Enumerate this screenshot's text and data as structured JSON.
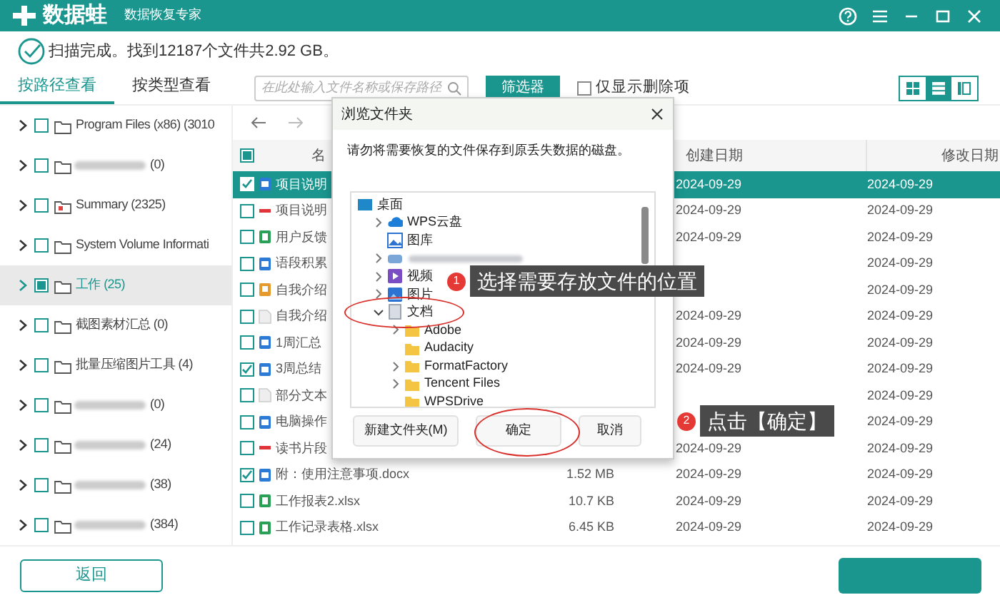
{
  "app": {
    "name": "数据蛙",
    "subtitle": "数据恢复专家"
  },
  "status": "扫描完成。找到12187个文件共2.92 GB。",
  "view_tabs": [
    {
      "label": "按路径查看",
      "selected": true
    },
    {
      "label": "按类型查看",
      "selected": false
    }
  ],
  "search": {
    "placeholder": "在此处输入文件名称或保存路径"
  },
  "filter_button": "筛选器",
  "deleted_only": {
    "label": "仅显示删除项",
    "checked": false
  },
  "layout_toggles": [
    {
      "kind": "grid",
      "selected": false
    },
    {
      "kind": "list",
      "selected": true
    },
    {
      "kind": "detail",
      "selected": false
    }
  ],
  "folder_tree": [
    {
      "label": "Program Files (x86) (3010",
      "blurred": false,
      "kind": "folder",
      "checked": false,
      "partial": false,
      "selected": false
    },
    {
      "label": "(0)",
      "blurred": true,
      "kind": "folder",
      "checked": false,
      "partial": false,
      "selected": false
    },
    {
      "label": "Summary (2325)",
      "blurred": false,
      "kind": "summary",
      "checked": false,
      "partial": false,
      "selected": false
    },
    {
      "label": "System Volume Informati",
      "blurred": false,
      "kind": "folder",
      "checked": false,
      "partial": false,
      "selected": false
    },
    {
      "label": "工作 (25)",
      "blurred": false,
      "kind": "folder",
      "checked": false,
      "partial": true,
      "selected": true
    },
    {
      "label": "截图素材汇总 (0)",
      "blurred": false,
      "kind": "folder",
      "checked": false,
      "partial": false,
      "selected": false
    },
    {
      "label": "批量压缩图片工具 (4)",
      "blurred": false,
      "kind": "folder",
      "checked": false,
      "partial": false,
      "selected": false
    },
    {
      "label": "(0)",
      "blurred": true,
      "kind": "folder",
      "checked": false,
      "partial": false,
      "selected": false
    },
    {
      "label": "(24)",
      "blurred": true,
      "kind": "folder",
      "checked": false,
      "partial": false,
      "selected": false
    },
    {
      "label": "(38)",
      "blurred": true,
      "kind": "folder",
      "checked": false,
      "partial": false,
      "selected": false
    },
    {
      "label": "(384)",
      "blurred": true,
      "kind": "folder",
      "checked": false,
      "partial": false,
      "selected": false
    }
  ],
  "back_button": "返回",
  "file_table": {
    "header_partial": true,
    "columns": {
      "name": "名",
      "created": "创建日期",
      "modified": "修改日期"
    },
    "rows": [
      {
        "kind": "word",
        "name": "项目说明",
        "created": "2024-09-29",
        "modified": "2024-09-29",
        "checked": true,
        "selected": true
      },
      {
        "kind": "pdf",
        "name": "项目说明",
        "created": "2024-09-29",
        "modified": "2024-09-29",
        "checked": false,
        "selected": false
      },
      {
        "kind": "excel",
        "name": "用户反馈",
        "created": "2024-09-29",
        "modified": "2024-09-29",
        "checked": false,
        "selected": false
      },
      {
        "kind": "word",
        "name": "语段积累",
        "modified": "2024-09-29",
        "checked": false,
        "selected": false
      },
      {
        "kind": "ppt",
        "name": "自我介绍",
        "modified": "2024-09-29",
        "checked": false,
        "selected": false
      },
      {
        "kind": "text",
        "name": "自我介绍",
        "created": "2024-09-29",
        "modified": "2024-09-29",
        "checked": false,
        "selected": false
      },
      {
        "kind": "word",
        "name": "1周汇总",
        "created": "2024-09-29",
        "modified": "2024-09-29",
        "checked": false,
        "selected": false
      },
      {
        "kind": "word",
        "name": "3周总结",
        "created": "2024-09-29",
        "modified": "2024-09-29",
        "checked": true,
        "selected": false
      },
      {
        "kind": "text",
        "name": "部分文本",
        "modified": "2024-09-29",
        "checked": false,
        "selected": false
      },
      {
        "kind": "word",
        "name": "电脑操作",
        "modified": "2024-09-29",
        "checked": false,
        "selected": false
      },
      {
        "kind": "pdf",
        "name": "读书片段",
        "created": "2024-09-29",
        "modified": "2024-09-29",
        "checked": false,
        "selected": false
      },
      {
        "kind": "word",
        "name": "附：使用注意事项.docx",
        "size": "1.52 MB",
        "created": "2024-09-29",
        "modified": "2024-09-29",
        "checked": true,
        "selected": false
      },
      {
        "kind": "excel",
        "name": "工作报表2.xlsx",
        "size": "10.7 KB",
        "created": "2024-09-29",
        "modified": "2024-09-29",
        "checked": false,
        "selected": false
      },
      {
        "kind": "excel",
        "name": "工作记录表格.xlsx",
        "size": "6.45 KB",
        "created": "2024-09-29",
        "modified": "2024-09-29",
        "checked": false,
        "selected": false
      }
    ]
  },
  "dialog": {
    "title": "浏览文件夹",
    "message": "请勿将需要恢复的文件保存到原丢失数据的磁盘。",
    "tree": [
      {
        "label": "桌面",
        "kind": "desktop",
        "children": [
          {
            "label": "WPS云盘",
            "kind": "cloud",
            "expandable": true,
            "expanded": false
          },
          {
            "label": "图库",
            "kind": "gallery",
            "expandable": false
          },
          {
            "blurred": true,
            "kind": "blurred",
            "expandable": true,
            "expanded": false
          },
          {
            "label": "视频",
            "kind": "video",
            "expandable": true,
            "expanded": false
          },
          {
            "label": "图片",
            "kind": "picture",
            "expandable": true,
            "expanded": false
          },
          {
            "label": "文档",
            "kind": "document",
            "expandable": true,
            "expanded": true,
            "children": [
              {
                "label": "Adobe",
                "kind": "folder",
                "expandable": true,
                "expanded": false
              },
              {
                "label": "Audacity",
                "kind": "folder",
                "expandable": false
              },
              {
                "label": "FormatFactory",
                "kind": "folder",
                "expandable": true,
                "expanded": false
              },
              {
                "label": "Tencent Files",
                "kind": "folder",
                "expandable": true,
                "expanded": false
              },
              {
                "label": "WPSDrive",
                "kind": "folder",
                "expandable": false
              }
            ]
          }
        ]
      }
    ],
    "buttons": [
      {
        "kind": "new_folder",
        "label": "新建文件夹(M)"
      },
      {
        "kind": "ok",
        "label": "确定"
      },
      {
        "kind": "cancel",
        "label": "取消"
      }
    ]
  },
  "callouts": [
    {
      "number": "1",
      "text": "选择需要存放文件的位置"
    },
    {
      "number": "2",
      "text": "点击【确定】"
    }
  ]
}
